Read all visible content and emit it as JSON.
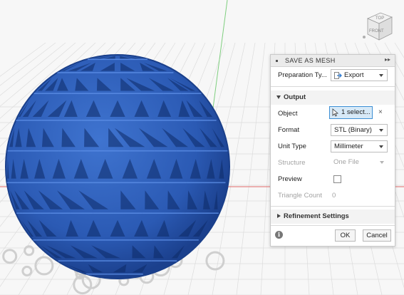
{
  "viewcube": {
    "top_label": "TOP",
    "front_label": "FRONT"
  },
  "dialog": {
    "title": "SAVE AS MESH",
    "preparation": {
      "label": "Preparation Ty...",
      "value": "Export"
    },
    "output_section": {
      "title": "Output",
      "object": {
        "label": "Object",
        "value": "1 select...",
        "clear": "×"
      },
      "format": {
        "label": "Format",
        "value": "STL (Binary)"
      },
      "unit_type": {
        "label": "Unit Type",
        "value": "Millimeter"
      },
      "structure": {
        "label": "Structure",
        "value": "One File"
      },
      "preview": {
        "label": "Preview",
        "checked": false
      },
      "triangle_count": {
        "label": "Triangle Count",
        "value": "0"
      }
    },
    "refinement_section": {
      "title": "Refinement Settings"
    },
    "info_glyph": "i",
    "buttons": {
      "ok": "OK",
      "cancel": "Cancel"
    }
  },
  "colors": {
    "mesh_blue": "#2f5fb8",
    "mesh_dark": "#1a3f8a",
    "selection_blue": "#3d8fd4",
    "axis_red": "#e26a6a",
    "axis_green": "#7fcf7f"
  }
}
